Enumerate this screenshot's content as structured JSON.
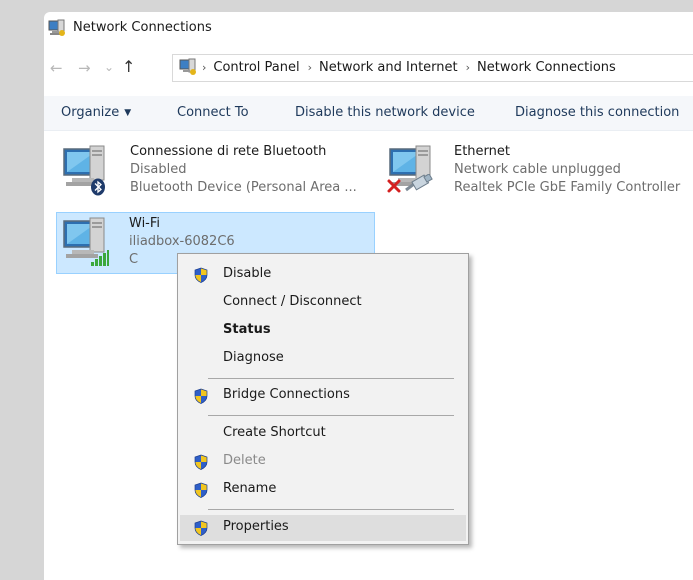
{
  "window": {
    "title": "Network Connections"
  },
  "nav": {
    "back": "←",
    "forward": "→",
    "recent": "⌄",
    "up": "↑"
  },
  "breadcrumb": {
    "items": [
      "Control Panel",
      "Network and Internet",
      "Network Connections"
    ],
    "separator": "›"
  },
  "toolbar": {
    "organize": "Organize",
    "organize_caret": "▼",
    "connect_to": "Connect To",
    "disable": "Disable this network device",
    "diagnose": "Diagnose this connection"
  },
  "connections": {
    "bluetooth": {
      "name": "Connessione di rete Bluetooth",
      "status": "Disabled",
      "device": "Bluetooth Device (Personal Area ...",
      "icon": "bluetooth-icon"
    },
    "ethernet": {
      "name": "Ethernet",
      "status": "Network cable unplugged",
      "device": "Realtek PCIe GbE Family Controller",
      "icon": "red-x-icon"
    },
    "wifi": {
      "name": "Wi-Fi",
      "ssid_partial": "iliadbox-6082C6",
      "status_partial": "C",
      "icon": "signal-bars-icon"
    }
  },
  "context_menu": {
    "items": [
      {
        "label": "Disable",
        "shield": true
      },
      {
        "label": "Connect / Disconnect",
        "shield": false
      },
      {
        "label": "Status",
        "shield": false,
        "bold": true
      },
      {
        "label": "Diagnose",
        "shield": false
      },
      {
        "label": "Bridge Connections",
        "shield": true
      },
      {
        "label": "Create Shortcut",
        "shield": false
      },
      {
        "label": "Delete",
        "shield": true,
        "disabled": true
      },
      {
        "label": "Rename",
        "shield": true
      },
      {
        "label": "Properties",
        "shield": true,
        "hovered": true
      }
    ]
  },
  "colors": {
    "background": "#d6d6d6",
    "window": "#ffffff",
    "selection": "#cce8ff",
    "selection_border": "#99d1ff",
    "toolbar_text": "#1e395b",
    "menu_bg": "#f2f2f2",
    "menu_hover": "#dedede",
    "shield_blue": "#2f5fc8",
    "shield_yellow": "#f2c61f"
  }
}
